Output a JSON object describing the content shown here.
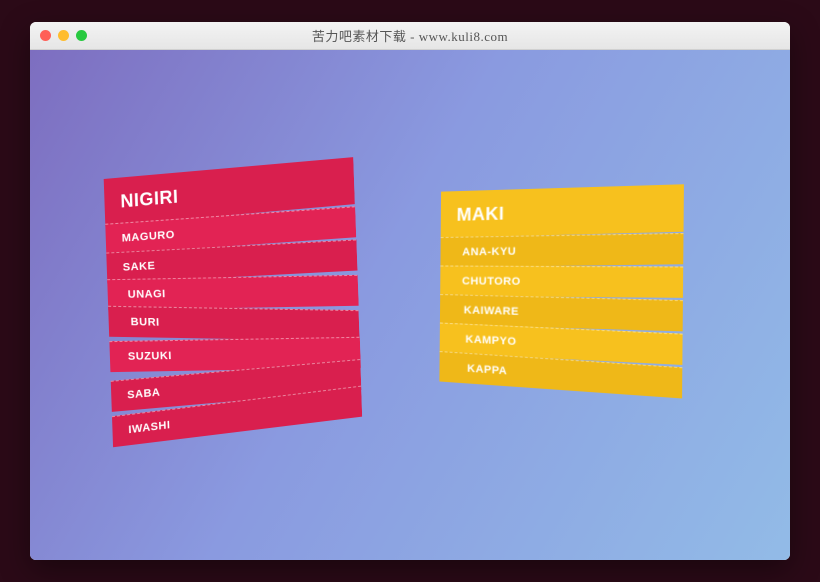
{
  "window": {
    "title": "苦力吧素材下载 - www.kuli8.com"
  },
  "menus": {
    "left": {
      "header": "NIGIRI",
      "items": [
        "MAGURO",
        "SAKE",
        "UNAGI",
        "BURI",
        "SUZUKI",
        "SABA",
        "IWASHI"
      ],
      "color": "#e22354"
    },
    "right": {
      "header": "MAKI",
      "items": [
        "ANA-KYU",
        "CHUTORO",
        "KAIWARE",
        "KAMPYO",
        "KAPPA"
      ],
      "color": "#f7c11e"
    }
  }
}
